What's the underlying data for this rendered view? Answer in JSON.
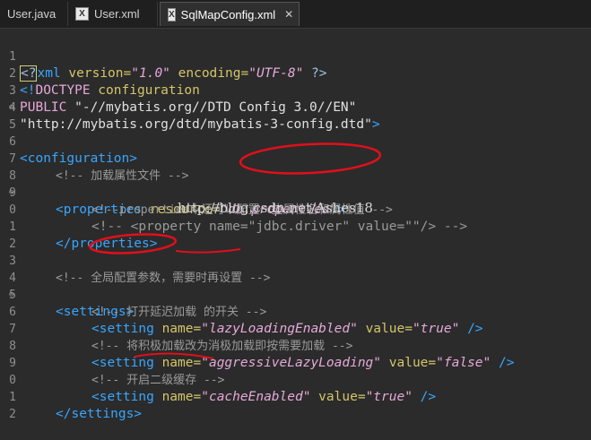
{
  "tabs": [
    {
      "label": "User.java",
      "active": false
    },
    {
      "label": "User.xml",
      "active": false
    },
    {
      "label": "SqlMapConfig.xml",
      "active": true
    }
  ],
  "lines": [
    {
      "n": "1",
      "fold": false
    },
    {
      "n": "2",
      "fold": false
    },
    {
      "n": "3",
      "fold": false
    },
    {
      "n": "4",
      "fold": false
    },
    {
      "n": "5",
      "fold": true
    },
    {
      "n": "6",
      "fold": false
    },
    {
      "n": "7",
      "fold": false
    },
    {
      "n": "8",
      "fold": true
    },
    {
      "n": "9",
      "fold": false
    },
    {
      "n": "0",
      "fold": false
    },
    {
      "n": "1",
      "fold": false
    },
    {
      "n": "2",
      "fold": false
    },
    {
      "n": "3",
      "fold": false
    },
    {
      "n": "4",
      "fold": true
    },
    {
      "n": "5",
      "fold": false
    },
    {
      "n": "6",
      "fold": false
    },
    {
      "n": "7",
      "fold": false
    },
    {
      "n": "8",
      "fold": false
    },
    {
      "n": "9",
      "fold": false
    },
    {
      "n": "0",
      "fold": false
    },
    {
      "n": "1",
      "fold": false
    },
    {
      "n": "2",
      "fold": false
    }
  ],
  "code": {
    "l1": {
      "a": "<?",
      "b": "xml",
      "c": " version=",
      "d": "\"1.0\"",
      "e": " encoding=",
      "f": "\"UTF-8\"",
      "g": " ?>"
    },
    "l2": {
      "a": "<!",
      "b": "DOCTYPE",
      "c": " configuration"
    },
    "l3": {
      "a": "PUBLIC ",
      "b": "\"-//mybatis.org//DTD Config 3.0//EN\""
    },
    "l4": {
      "a": "\"http://mybatis.org/dtd/mybatis-3-config.dtd\"",
      "b": ">"
    },
    "l5": {
      "a": "<configuration>"
    },
    "l7": {
      "a": "<!-- 加载属性文件 -->"
    },
    "l8": {
      "a": "<properties",
      "b": " resource=",
      "c": "\"db.properties\"",
      "d": ">"
    },
    "l9": {
      "a": "<!--properties中还可以配置一些属性名和属性值 -->"
    },
    "l10": {
      "a": "<!-- <property name=\"jdbc.driver\" value=\"\"/> -->"
    },
    "l11": {
      "a": "</properties>"
    },
    "l13": {
      "a": "<!-- 全局配置参数，需要时再设置 -->"
    },
    "l14": {
      "a": "<settings>"
    },
    "l15": {
      "a": "<!-- 打开延迟加载 的开关 -->"
    },
    "l16": {
      "a": "<setting",
      "b": " name=",
      "c": "\"lazyLoadingEnabled\"",
      "d": " value=",
      "e": "\"true\"",
      "f": " />"
    },
    "l17": {
      "a": "<!-- 将积极加载改为消极加载即按需要加载 -->"
    },
    "l18": {
      "a": "<setting",
      "b": " name=",
      "c": "\"aggressiveLazyLoading\"",
      "d": " value=",
      "e": "\"false\"",
      "f": " />"
    },
    "l19": {
      "a": "<!-- 开启二级缓存 -->"
    },
    "l20": {
      "a": "<setting",
      "b": " name=",
      "c": "\"cacheEnabled\"",
      "d": " value=",
      "e": "\"true\"",
      "f": " />"
    },
    "l21": {
      "a": "</settings>"
    }
  },
  "watermark": "http://blog.csdn.net/Ashes18",
  "colors": {
    "tag": "#38a6ff",
    "attr": "#d4c56a",
    "value": "#e6a8d9",
    "comment": "#9a9a9a",
    "annotation": "#e0101a"
  }
}
